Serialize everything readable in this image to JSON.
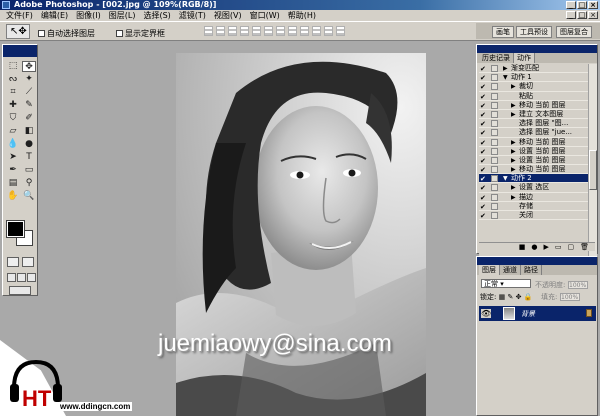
{
  "window": {
    "title": "Adobe Photoshop - [002.jpg @ 109%(RGB/8)]"
  },
  "menu": [
    "文件(F)",
    "编辑(E)",
    "图像(I)",
    "图层(L)",
    "选择(S)",
    "滤镜(T)",
    "视图(V)",
    "窗口(W)",
    "帮助(H)"
  ],
  "options": {
    "auto_select": "自动选择图层",
    "show_bounds": "显示定界框"
  },
  "palette_well": [
    "画笔",
    "工具预设",
    "图层复合"
  ],
  "actions_panel": {
    "tabs": [
      "历史记录",
      "动作"
    ],
    "rows": [
      {
        "indent": 1,
        "label": "渐变匹配",
        "state": "partial",
        "arrow": "▶"
      },
      {
        "indent": 1,
        "label": "动作 1",
        "state": "open",
        "arrow": "▼"
      },
      {
        "indent": 2,
        "label": "裁切",
        "arrow": "▶"
      },
      {
        "indent": 2,
        "label": "粘贴",
        "arrow": ""
      },
      {
        "indent": 2,
        "label": "移动 当前 图层",
        "arrow": "▶"
      },
      {
        "indent": 2,
        "label": "建立 文本图层",
        "arrow": "▶"
      },
      {
        "indent": 2,
        "label": "选择 图层 \"图...",
        "arrow": ""
      },
      {
        "indent": 2,
        "label": "选择 图层 \"jue...",
        "arrow": ""
      },
      {
        "indent": 2,
        "label": "移动 当前 图层",
        "arrow": "▶"
      },
      {
        "indent": 2,
        "label": "设置 当前 图层",
        "arrow": "▶"
      },
      {
        "indent": 2,
        "label": "设置 当前 图层",
        "arrow": "▶"
      },
      {
        "indent": 2,
        "label": "移动 当前 图层",
        "arrow": "▶"
      },
      {
        "indent": 1,
        "label": "动作 2",
        "arrow": "▼",
        "selected": true
      },
      {
        "indent": 2,
        "label": "设置 选区",
        "arrow": "▶"
      },
      {
        "indent": 2,
        "label": "描边",
        "arrow": "▶"
      },
      {
        "indent": 2,
        "label": "存储",
        "arrow": ""
      },
      {
        "indent": 2,
        "label": "关闭",
        "arrow": ""
      }
    ]
  },
  "layers_panel": {
    "tabs": [
      "图层",
      "通道",
      "路径"
    ],
    "blend_mode": "正常",
    "opacity_label": "不透明度:",
    "opacity_value": "100%",
    "lock_label": "锁定:",
    "fill_label": "填充:",
    "fill_value": "100%",
    "layer_name": "背景"
  },
  "watermark_text": "juemiaowy@sina.com",
  "site_url": "www.ddingcn.com",
  "logo_letters": "HT"
}
